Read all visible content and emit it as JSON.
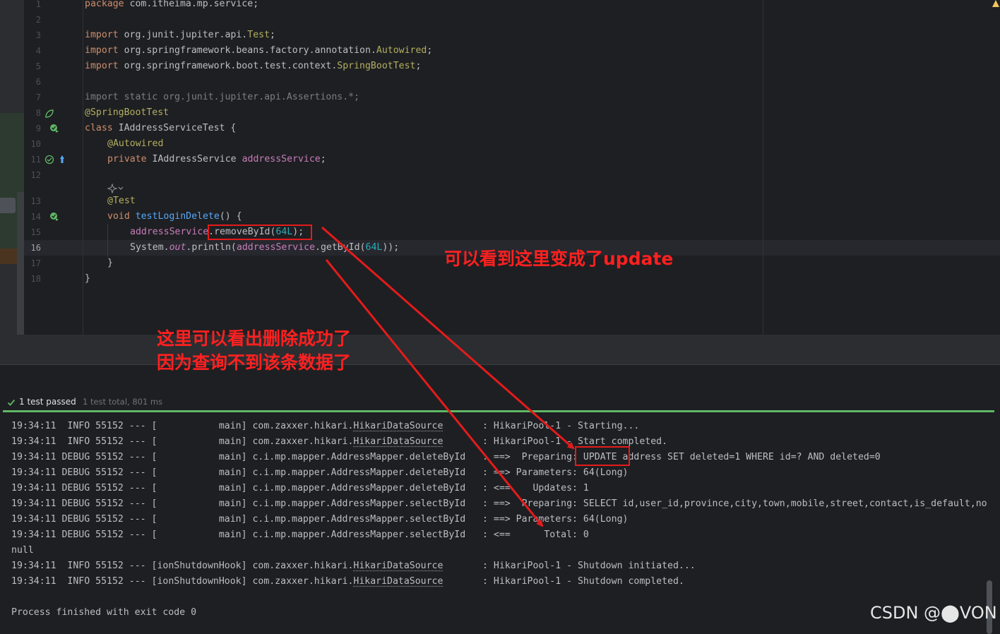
{
  "editor": {
    "line_numbers": [
      "1",
      "2",
      "3",
      "4",
      "5",
      "6",
      "7",
      "8",
      "9",
      "10",
      "11",
      "12",
      "13",
      "14",
      "15",
      "16",
      "17",
      "18"
    ],
    "lines": {
      "l1": {
        "kw": "package",
        "rest": " com.itheima.mp.service;"
      },
      "l3": {
        "kw": "import",
        "rest": " org.junit.jupiter.api.",
        "cls": "Test",
        "end": ";"
      },
      "l4": {
        "kw": "import",
        "rest": " org.springframework.beans.factory.annotation.",
        "cls": "Autowired",
        "end": ";"
      },
      "l5": {
        "kw": "import",
        "rest": " org.springframework.boot.test.context.",
        "cls": "SpringBootTest",
        "end": ";"
      },
      "l7": {
        "text": "import static org.junit.jupiter.api.Assertions.*;"
      },
      "l8": {
        "ann": "@SpringBootTest"
      },
      "l9": {
        "kw": "class",
        "rest": " IAddressServiceTest {"
      },
      "l10": {
        "ann": "@Autowired"
      },
      "l11": {
        "kw": "private",
        "type": " IAddressService ",
        "field": "addressService",
        "end": ";"
      },
      "l13": {
        "ann": "@Test"
      },
      "l14": {
        "kw": "void",
        "fn": " testLoginDelete",
        "end": "() {"
      },
      "l15": {
        "field": "addressService",
        "mid": ".removeById(",
        "num": "64L",
        "end": ");"
      },
      "l16": {
        "start": "System.",
        "out": "out",
        "mid": ".println(",
        "field": "addressService",
        "mid2": ".getById(",
        "num": "64L",
        "end": "));"
      },
      "l17": {
        "text": "}"
      },
      "l18": {
        "text": "}"
      }
    }
  },
  "annotations": {
    "update_note": "可以看到这里变成了update",
    "delete_note_line1": "这里可以看出删除成功了",
    "delete_note_line2": "因为查询不到该条数据了"
  },
  "run_panel": {
    "status": "1 test passed",
    "summary": "1 test total, 801 ms",
    "log_lines": [
      {
        "time": "19:34:11",
        "level": " INFO",
        "pid": "55152",
        "sep": " --- [",
        "thread": "           main]",
        "logger_pre": " com.zaxxer.hikari.",
        "logger_ul": "HikariDataSource",
        "pad": "       ",
        "msg": ": HikariPool-1 - Starting..."
      },
      {
        "time": "19:34:11",
        "level": " INFO",
        "pid": "55152",
        "sep": " --- [",
        "thread": "           main]",
        "logger_pre": " com.zaxxer.hikari.",
        "logger_ul": "HikariDataSource",
        "pad": "       ",
        "msg": ": HikariPool-1 - Start completed."
      },
      {
        "time": "19:34:11",
        "level": "DEBUG",
        "pid": "55152",
        "sep": " --- [",
        "thread": "           main]",
        "logger_pre": " c.i.mp.mapper.AddressMapper.deleteById",
        "logger_ul": "",
        "pad": "   ",
        "msg": ": ==>  Preparing: UPDATE address SET deleted=1 WHERE id=? AND deleted=0"
      },
      {
        "time": "19:34:11",
        "level": "DEBUG",
        "pid": "55152",
        "sep": " --- [",
        "thread": "           main]",
        "logger_pre": " c.i.mp.mapper.AddressMapper.deleteById",
        "logger_ul": "",
        "pad": "   ",
        "msg": ": ==> Parameters: 64(Long)"
      },
      {
        "time": "19:34:11",
        "level": "DEBUG",
        "pid": "55152",
        "sep": " --- [",
        "thread": "           main]",
        "logger_pre": " c.i.mp.mapper.AddressMapper.deleteById",
        "logger_ul": "",
        "pad": "   ",
        "msg": ": <==    Updates: 1"
      },
      {
        "time": "19:34:11",
        "level": "DEBUG",
        "pid": "55152",
        "sep": " --- [",
        "thread": "           main]",
        "logger_pre": " c.i.mp.mapper.AddressMapper.selectById",
        "logger_ul": "",
        "pad": "   ",
        "msg": ": ==>  Preparing: SELECT id,user_id,province,city,town,mobile,street,contact,is_default,no"
      },
      {
        "time": "19:34:11",
        "level": "DEBUG",
        "pid": "55152",
        "sep": " --- [",
        "thread": "           main]",
        "logger_pre": " c.i.mp.mapper.AddressMapper.selectById",
        "logger_ul": "",
        "pad": "   ",
        "msg": ": ==> Parameters: 64(Long)"
      },
      {
        "time": "19:34:11",
        "level": "DEBUG",
        "pid": "55152",
        "sep": " --- [",
        "thread": "           main]",
        "logger_pre": " c.i.mp.mapper.AddressMapper.selectById",
        "logger_ul": "",
        "pad": "   ",
        "msg": ": <==      Total: 0"
      },
      {
        "plain": "null"
      },
      {
        "time": "19:34:11",
        "level": " INFO",
        "pid": "55152",
        "sep": " --- [",
        "thread": "ionShutdownHook]",
        "logger_pre": " com.zaxxer.hikari.",
        "logger_ul": "HikariDataSource",
        "pad": "       ",
        "msg": ": HikariPool-1 - Shutdown initiated..."
      },
      {
        "time": "19:34:11",
        "level": " INFO",
        "pid": "55152",
        "sep": " --- [",
        "thread": "ionShutdownHook]",
        "logger_pre": " com.zaxxer.hikari.",
        "logger_ul": "HikariDataSource",
        "pad": "       ",
        "msg": ": HikariPool-1 - Shutdown completed."
      },
      {
        "plain": ""
      },
      {
        "plain": "Process finished with exit code 0"
      }
    ]
  },
  "watermark": "CSDN @⬤VON",
  "colors": {
    "accent_red": "#e41b1b",
    "pass_green": "#5fb865"
  }
}
